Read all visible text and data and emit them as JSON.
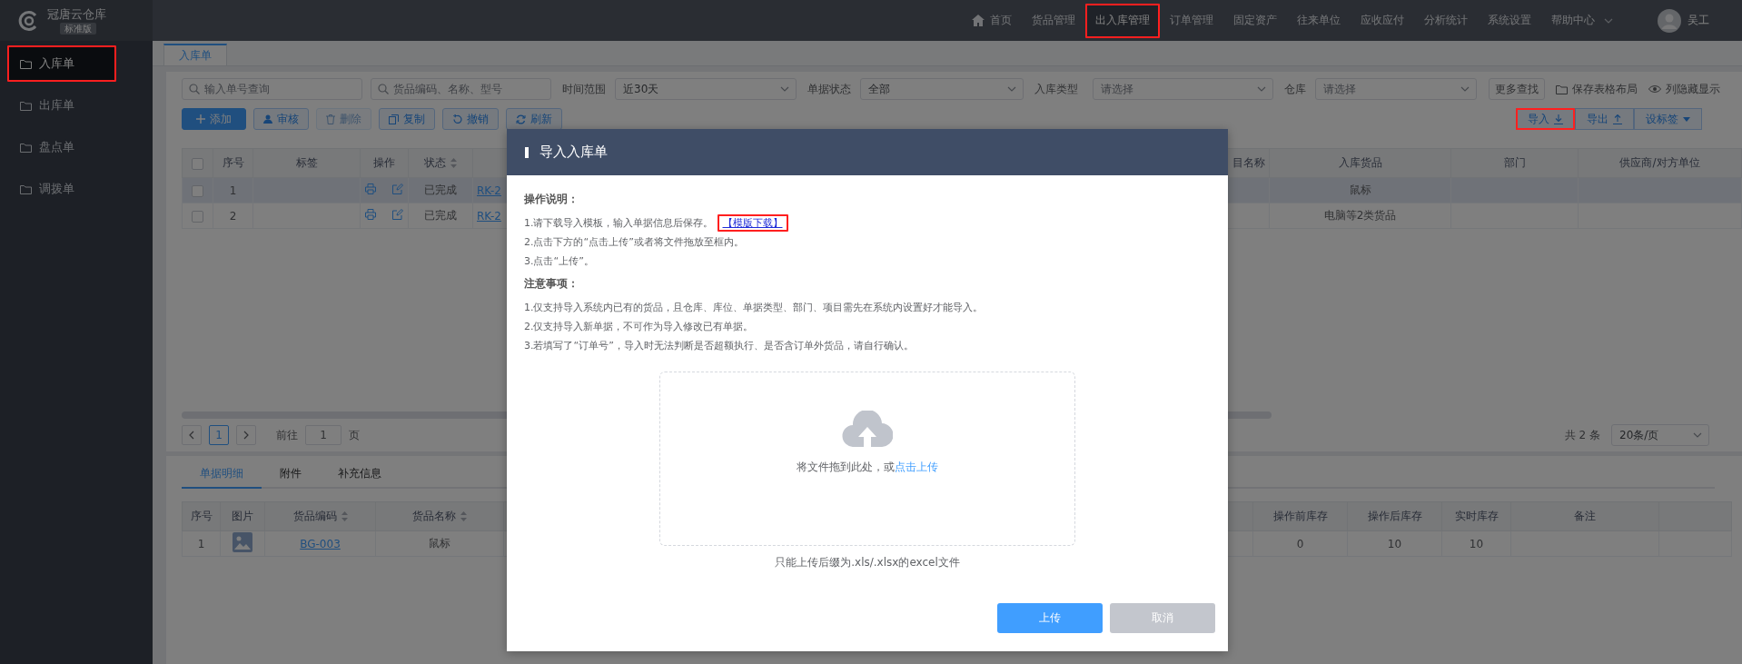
{
  "app": {
    "name": "冠唐云仓库",
    "edition": "标准版"
  },
  "top_nav": {
    "items": [
      {
        "label": "首页",
        "kind": "home",
        "selected": false,
        "highlighted": false
      },
      {
        "label": "货品管理",
        "kind": "plain",
        "selected": false,
        "highlighted": false
      },
      {
        "label": "出入库管理",
        "kind": "plain",
        "selected": true,
        "highlighted": true
      },
      {
        "label": "订单管理",
        "kind": "plain",
        "selected": false,
        "highlighted": false
      },
      {
        "label": "固定资产",
        "kind": "plain",
        "selected": false,
        "highlighted": false
      },
      {
        "label": "往来单位",
        "kind": "plain",
        "selected": false,
        "highlighted": false
      },
      {
        "label": "应收应付",
        "kind": "plain",
        "selected": false,
        "highlighted": false
      },
      {
        "label": "分析统计",
        "kind": "plain",
        "selected": false,
        "highlighted": false
      },
      {
        "label": "系统设置",
        "kind": "plain",
        "selected": false,
        "highlighted": false
      },
      {
        "label": "帮助中心",
        "kind": "dropdown",
        "selected": false,
        "highlighted": false
      }
    ],
    "user": {
      "name": "吴工"
    }
  },
  "sidebar": {
    "items": [
      {
        "label": "入库单",
        "selected": true,
        "highlighted": true
      },
      {
        "label": "出库单",
        "selected": false,
        "highlighted": false
      },
      {
        "label": "盘点单",
        "selected": false,
        "highlighted": false
      },
      {
        "label": "调拨单",
        "selected": false,
        "highlighted": false
      }
    ]
  },
  "page_tabs": [
    {
      "label": "入库单",
      "selected": true
    }
  ],
  "filters": {
    "searches": [
      {
        "placeholder": "输入单号查询"
      },
      {
        "placeholder": "货品编码、名称、型号"
      }
    ],
    "selects": [
      {
        "label": "时间范围",
        "value": "近30天"
      },
      {
        "label": "单据状态",
        "value": "全部"
      },
      {
        "label": "入库类型",
        "placeholder": "请选择"
      },
      {
        "label": "仓库",
        "placeholder": "请选择"
      }
    ],
    "more_button": "更多查找",
    "links": [
      {
        "label": "保存表格布局"
      },
      {
        "label": "列隐藏显示"
      }
    ]
  },
  "toolbar": {
    "left": [
      {
        "label": "添加",
        "kind": "primary",
        "disabled": false
      },
      {
        "label": "审核",
        "kind": "plain",
        "disabled": false
      },
      {
        "label": "删除",
        "kind": "plain",
        "disabled": true
      },
      {
        "label": "复制",
        "kind": "plain",
        "disabled": false
      },
      {
        "label": "撤销",
        "kind": "plain",
        "disabled": false
      },
      {
        "label": "刷新",
        "kind": "plain",
        "disabled": false
      }
    ],
    "right": [
      {
        "label": "导入",
        "highlighted": true
      },
      {
        "label": "导出",
        "highlighted": false
      },
      {
        "label": "设标签",
        "highlighted": false
      }
    ]
  },
  "table": {
    "all_checked": false,
    "columns": [
      {
        "kind": "checkbox"
      },
      {
        "label": "序号",
        "kind": "text"
      },
      {
        "label": "标签",
        "kind": "text"
      },
      {
        "label": "操作",
        "kind": "actions"
      },
      {
        "label": "状态",
        "kind": "text",
        "sortable": true
      },
      {
        "kind": "link"
      },
      {
        "kind": "blank"
      },
      {
        "label": "目名称",
        "kind": "text"
      },
      {
        "label": "入库货品",
        "kind": "text"
      },
      {
        "label": "部门",
        "kind": "text"
      },
      {
        "label": "供应商/对方单位",
        "kind": "text"
      }
    ],
    "rows": [
      {
        "selected": true,
        "checked": false,
        "index": "1",
        "status": "已完成",
        "code": "RK-2",
        "goods": "鼠标"
      },
      {
        "selected": false,
        "checked": false,
        "index": "2",
        "status": "已完成",
        "code": "RK-2",
        "goods": "电脑等2类货品"
      }
    ]
  },
  "pagination": {
    "current": "1",
    "goto_label": "前往",
    "goto_value": "1",
    "page_unit": "页",
    "total": "共 2 条",
    "page_size": "20条/页"
  },
  "detail_tabs": [
    {
      "label": "单据明细",
      "selected": true
    },
    {
      "label": "附件",
      "selected": false
    },
    {
      "label": "补充信息",
      "selected": false
    }
  ],
  "detail_table": {
    "columns": [
      {
        "label": "序号",
        "kind": "text"
      },
      {
        "label": "图片",
        "kind": "image"
      },
      {
        "label": "货品编码",
        "kind": "link",
        "sortable": true
      },
      {
        "label": "货品名称",
        "kind": "text",
        "sortable": true
      },
      {
        "kind": "blank"
      },
      {
        "label": "操作前库存",
        "kind": "text"
      },
      {
        "label": "操作后库存",
        "kind": "text"
      },
      {
        "label": "实时库存",
        "kind": "text"
      },
      {
        "label": "备注",
        "kind": "text"
      },
      {
        "kind": "blank"
      }
    ],
    "rows": [
      {
        "index": "1",
        "code": "BG-003",
        "name": "鼠标",
        "before": "0",
        "after": "10",
        "current": "10"
      }
    ]
  },
  "modal": {
    "title": "导入入库单",
    "sections": [
      {
        "heading": "操作说明：",
        "lines": [
          {
            "text": "1.请下载导入模板，输入单据信息后保存。",
            "link": "【模版下载】",
            "link_highlighted": true
          },
          {
            "text": "2.点击下方的“点击上传”或者将文件拖放至框内。"
          },
          {
            "text": "3.点击“上传”。"
          }
        ]
      },
      {
        "heading": "注意事项：",
        "lines": [
          {
            "text": "1.仅支持导入系统内已有的货品，且仓库、库位、单据类型、部门、项目需先在系统内设置好才能导入。"
          },
          {
            "text": "2.仅支持导入新单据，不可作为导入修改已有单据。"
          },
          {
            "text": "3.若填写了“订单号”，导入时无法判断是否超额执行、是否含订单外货品，请自行确认。"
          }
        ]
      }
    ],
    "dropzone": {
      "text": "将文件拖到此处，或",
      "link": "点击上传"
    },
    "hint": "只能上传后缀为.xls/.xlsx的excel文件",
    "buttons": [
      {
        "label": "上传",
        "kind": "primary"
      },
      {
        "label": "取消",
        "kind": "secondary"
      }
    ]
  }
}
